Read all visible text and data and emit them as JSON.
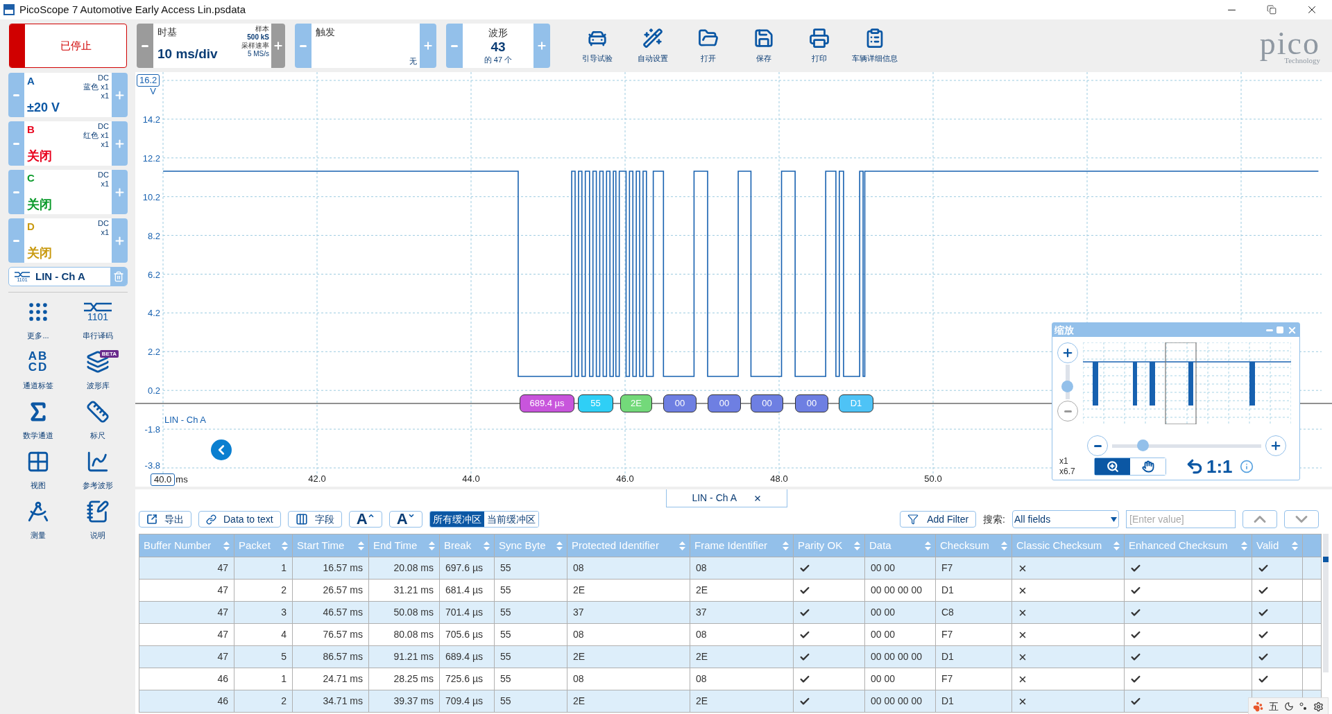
{
  "window": {
    "title": "PicoScope 7 Automotive Early Access Lin.psdata"
  },
  "toolbar": {
    "run_button": {
      "label": "已停止",
      "running": false
    },
    "timebase": {
      "label": "时基",
      "value": "10 ms/div",
      "samples_label": "样本",
      "samples": "500 kS",
      "rate_label": "采样速率",
      "rate": "5 MS/s"
    },
    "trigger": {
      "label": "触发",
      "mode": "无"
    },
    "waveform": {
      "label": "波形",
      "number": "43",
      "count": "的 47 个"
    },
    "tools": [
      {
        "kind": "car",
        "label": "引导试验"
      },
      {
        "kind": "wand",
        "label": "自动设置"
      },
      {
        "kind": "folder",
        "label": "打开"
      },
      {
        "kind": "save",
        "label": "保存"
      },
      {
        "kind": "print",
        "label": "打印"
      },
      {
        "kind": "clipboard",
        "label": "车辆详细信息"
      }
    ],
    "logo": {
      "name": "pico",
      "tagline": "Technology"
    }
  },
  "channels": [
    {
      "name": "A",
      "coupling": "DC",
      "probe": "蓝色 x1",
      "scale": "x1",
      "range": "±20 V",
      "color": "#0b57a4"
    },
    {
      "name": "B",
      "coupling": "DC",
      "probe": "红色 x1",
      "scale": "x1",
      "range": "关闭",
      "color": "#e8001c"
    },
    {
      "name": "C",
      "coupling": "DC",
      "scale": "x1",
      "range": "关闭",
      "color": "#0a9a2a"
    },
    {
      "name": "D",
      "coupling": "DC",
      "scale": "x1",
      "range": "关闭",
      "color": "#c99a10"
    }
  ],
  "decoder": {
    "label": "LIN - Ch A",
    "icon_text": "1101"
  },
  "side_tools": [
    {
      "kind": "more",
      "label": "更多..."
    },
    {
      "kind": "serial",
      "label": "串行译码",
      "icon_text": "1101"
    },
    {
      "kind": "labels",
      "label": "通道标签",
      "icon_text": [
        "AB",
        "CD"
      ]
    },
    {
      "kind": "library",
      "label": "波形库",
      "badge": "BETA"
    },
    {
      "kind": "math",
      "label": "数学通道"
    },
    {
      "kind": "ruler",
      "label": "标尺"
    },
    {
      "kind": "view",
      "label": "视图"
    },
    {
      "kind": "reference",
      "label": "参考波形"
    },
    {
      "kind": "measure",
      "label": "测量"
    },
    {
      "kind": "notes",
      "label": "说明"
    }
  ],
  "scope": {
    "y_ticks": [
      "16.2",
      "14.2",
      "12.2",
      "10.2",
      "8.2",
      "6.2",
      "4.2",
      "2.2",
      "0.2",
      "-1.8",
      "-3.8"
    ],
    "y_unit": "V",
    "x_ticks": [
      "40.0",
      "42.0",
      "44.0",
      "46.0",
      "48.0",
      "50.0"
    ],
    "x_unit": "ms",
    "trace_label": "LIN - Ch A",
    "packets": [
      {
        "label": "689.4 µs",
        "color": "#c855dc"
      },
      {
        "label": "55",
        "color": "#2fcff6"
      },
      {
        "label": "2E",
        "color": "#73d97a"
      },
      {
        "label": "00",
        "color": "#6e7fe2"
      },
      {
        "label": "00",
        "color": "#6e7fe2"
      },
      {
        "label": "00",
        "color": "#6e7fe2"
      },
      {
        "label": "00",
        "color": "#6e7fe2"
      },
      {
        "label": "D1",
        "color": "#4ec3f6"
      }
    ]
  },
  "zoom_panel": {
    "title": "缩放",
    "vertical": {
      "level": 0.3
    },
    "horizontal": {
      "level": 0.18
    },
    "zoom_x": "x1",
    "zoom_y": "x6.7",
    "reset": "1:1",
    "modes": [
      {
        "kind": "zoom",
        "selected": true
      },
      {
        "kind": "pan",
        "selected": false
      }
    ]
  },
  "decode_panel": {
    "tab": {
      "label": "LIN - Ch A"
    },
    "buttons": [
      {
        "kind": "export",
        "label": "导出"
      },
      {
        "kind": "link",
        "label": "Data to text"
      },
      {
        "kind": "columns",
        "label": "字段"
      },
      {
        "kind": "bigger",
        "label": "A"
      },
      {
        "kind": "smaller",
        "label": "A"
      }
    ],
    "buffers": [
      {
        "label": "所有缓冲区",
        "selected": true
      },
      {
        "label": "当前缓冲区",
        "selected": false
      }
    ],
    "filter_button": "Add Filter",
    "search_label": "搜索:",
    "search_field": "All fields",
    "value_placeholder": "[Enter value]",
    "columns": [
      {
        "label": "Buffer Number",
        "kind": "number"
      },
      {
        "label": "Packet",
        "kind": "number"
      },
      {
        "label": "Start Time",
        "kind": "number"
      },
      {
        "label": "End Time",
        "kind": "number"
      },
      {
        "label": "Break",
        "kind": "text"
      },
      {
        "label": "Sync Byte",
        "kind": "text"
      },
      {
        "label": "Protected Identifier",
        "kind": "text"
      },
      {
        "label": "Frame Identifier",
        "kind": "text"
      },
      {
        "label": "Parity OK",
        "kind": "bool"
      },
      {
        "label": "Data",
        "kind": "text"
      },
      {
        "label": "Checksum",
        "kind": "text"
      },
      {
        "label": "Classic Checksum",
        "kind": "bool"
      },
      {
        "label": "Enhanced Checksum",
        "kind": "bool"
      },
      {
        "label": "Valid",
        "kind": "bool"
      }
    ],
    "rows": [
      {
        "cells": [
          "47",
          "1",
          "16.57 ms",
          "20.08 ms",
          "697.6 µs",
          "55",
          "08",
          "08",
          true,
          "00 00",
          "F7",
          false,
          true,
          true
        ]
      },
      {
        "cells": [
          "47",
          "2",
          "26.57 ms",
          "31.21 ms",
          "681.4 µs",
          "55",
          "2E",
          "2E",
          true,
          "00 00 00 00",
          "D1",
          false,
          true,
          true
        ]
      },
      {
        "cells": [
          "47",
          "3",
          "46.57 ms",
          "50.08 ms",
          "701.4 µs",
          "55",
          "37",
          "37",
          true,
          "00 00",
          "C8",
          false,
          true,
          true
        ]
      },
      {
        "cells": [
          "47",
          "4",
          "76.57 ms",
          "80.08 ms",
          "705.6 µs",
          "55",
          "08",
          "08",
          true,
          "00 00",
          "F7",
          false,
          true,
          true
        ]
      },
      {
        "cells": [
          "47",
          "5",
          "86.57 ms",
          "91.21 ms",
          "689.4 µs",
          "55",
          "2E",
          "2E",
          true,
          "00 00 00 00",
          "D1",
          false,
          true,
          true
        ]
      },
      {
        "cells": [
          "46",
          "1",
          "24.71 ms",
          "28.25 ms",
          "725.6 µs",
          "55",
          "08",
          "08",
          true,
          "00 00",
          "F7",
          false,
          true,
          true
        ]
      },
      {
        "cells": [
          "46",
          "2",
          "34.71 ms",
          "39.37 ms",
          "709.4 µs",
          "55",
          "2E",
          "2E",
          true,
          "00 00 00 00",
          "D1",
          false,
          true
        ]
      }
    ]
  },
  "ime_bar": {
    "mode": "五"
  }
}
